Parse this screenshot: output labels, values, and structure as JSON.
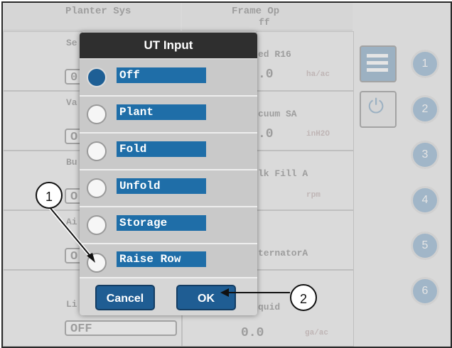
{
  "background": {
    "header_left": "Planter Sys",
    "header_right": "Frame Op",
    "header_right_value": "ff",
    "tiles_left": [
      {
        "title": "Se",
        "value": "0"
      },
      {
        "title": "Va",
        "value": "O"
      },
      {
        "title": "Bu",
        "value": "O"
      },
      {
        "title": "Ai",
        "value": "O"
      },
      {
        "title": "Li",
        "value": "OFF"
      }
    ],
    "tiles_right": [
      {
        "title": "ed R16",
        "value": ".0",
        "unit": "ha/ac"
      },
      {
        "title": "cuum   SA",
        "value": ".0",
        "unit": "inH2O"
      },
      {
        "title": "lk Fill A",
        "value": "",
        "unit": "rpm"
      },
      {
        "title": "ternatorA",
        "value": "",
        "unit": ""
      },
      {
        "title": "quid",
        "value": "0.0",
        "unit": "ga/ac"
      }
    ],
    "side_numbers": [
      "1",
      "2",
      "3",
      "4",
      "5",
      "6"
    ]
  },
  "dialog": {
    "title": "UT Input",
    "options": [
      {
        "label": "Off",
        "selected": true
      },
      {
        "label": "Plant",
        "selected": false
      },
      {
        "label": "Fold",
        "selected": false
      },
      {
        "label": "Unfold",
        "selected": false
      },
      {
        "label": "Storage",
        "selected": false
      },
      {
        "label": "Raise Row",
        "selected": false
      }
    ],
    "cancel_label": "Cancel",
    "ok_label": "OK"
  },
  "callouts": [
    "1",
    "2"
  ],
  "colors": {
    "accent": "#1f6ea8",
    "button": "#1f5d93",
    "header": "#2f2f2f"
  }
}
